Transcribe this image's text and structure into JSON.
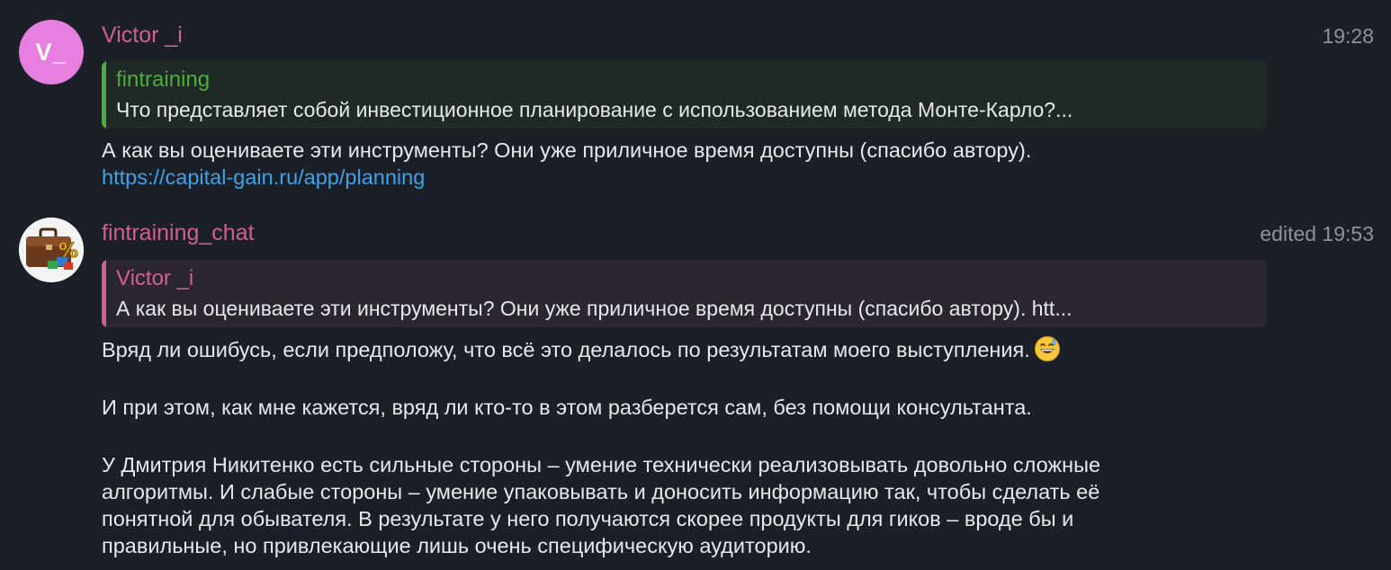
{
  "colors": {
    "background": "#1b1f27",
    "sender_name": "#d1608f",
    "link": "#3fa2e8",
    "reply1_accent": "#4cae3a",
    "reply1_bg": "#1f2a26",
    "reply2_accent": "#d1608f",
    "reply2_bg": "#2c2630"
  },
  "messages": [
    {
      "avatar": {
        "initials": "V_",
        "color": "#e67fe0"
      },
      "sender": "Victor _i",
      "time": "19:28",
      "reply": {
        "author": "fintraining",
        "text": "Что представляет собой инвестиционное планирование с использованием метода Монте-Карло?..."
      },
      "text": "А как вы оцениваете эти инструменты? Они уже приличное время доступны (спасибо автору).",
      "link": "https://capital-gain.ru/app/planning"
    },
    {
      "avatar": {
        "icon": "briefcase-percent-icon"
      },
      "sender": "fintraining_chat",
      "time": "edited 19:53",
      "reply": {
        "author": "Victor _i",
        "text": "А как вы оцениваете эти инструменты? Они уже приличное время доступны (спасибо автору). htt..."
      },
      "paragraphs": [
        "Вряд ли ошибусь, если предположу, что всё это делалось по результатам моего выступления.",
        "И при этом, как мне кажется, вряд ли кто-то в этом разберется сам, без помощи консультанта.",
        "У Дмитрия Никитенко есть сильные стороны – умение технически реализовывать довольно сложные\nалгоритмы. И слабые стороны – умение упаковывать и доносить информацию так, чтобы сделать её\nпонятной для обывателя. В результате у него получаются скорее продукты для гиков – вроде бы и\nправильные, но привлекающие лишь очень специфическую аудиторию."
      ],
      "emoji": "grinning-sweat-emoji"
    }
  ]
}
